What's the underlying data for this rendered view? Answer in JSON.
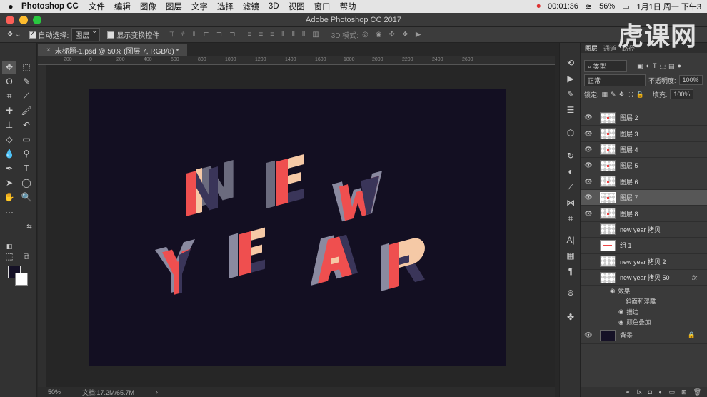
{
  "menubar": {
    "app_name": "Photoshop CC",
    "items": [
      "文件",
      "编辑",
      "图像",
      "图层",
      "文字",
      "选择",
      "滤镜",
      "3D",
      "视图",
      "窗口",
      "帮助"
    ],
    "time": "00:01:36",
    "battery": "56%",
    "date": "1月1日 周一 下午3"
  },
  "window": {
    "title": "Adobe Photoshop CC 2017"
  },
  "watermark": "虎课网",
  "options": {
    "auto_select_label": "自动选择:",
    "auto_select_value": "图层",
    "transform_label": "显示变换控件",
    "mode_3d_label": "3D 模式:"
  },
  "document": {
    "tab_title": "未标题-1.psd @ 50% (图层 7, RGB/8) *",
    "zoom": "50%",
    "doc_size": "文档:17.2M/65.7M",
    "ruler_ticks": [
      "200",
      "0",
      "200",
      "400",
      "600",
      "800",
      "1000",
      "1200",
      "1400",
      "1600",
      "1800",
      "2000",
      "2200",
      "2400",
      "2600"
    ],
    "artwork_lines": [
      "NEW",
      "YEAR"
    ]
  },
  "colors": {
    "foreground": "#151126",
    "background": "#ffffff",
    "canvas": "#130f22",
    "letter_red": "#ef4f4f",
    "letter_peach": "#f5c9a6",
    "letter_purple": "#3a3559"
  },
  "layers_panel": {
    "tabs": [
      "图层",
      "通道",
      "路径"
    ],
    "filter_label": "类型",
    "blend_mode": "正常",
    "opacity_label": "不透明度:",
    "opacity_value": "100%",
    "lock_label": "锁定:",
    "fill_label": "填充:",
    "fill_value": "100%",
    "layers": [
      {
        "name": "图层 2",
        "visible": true
      },
      {
        "name": "图层 3",
        "visible": true
      },
      {
        "name": "图层 4",
        "visible": true
      },
      {
        "name": "图层 5",
        "visible": true
      },
      {
        "name": "图层 6",
        "visible": true
      },
      {
        "name": "图层 7",
        "visible": true,
        "selected": true
      },
      {
        "name": "图层 8",
        "visible": true
      },
      {
        "name": "new year 拷贝",
        "visible": false
      },
      {
        "name": "组 1",
        "visible": false
      },
      {
        "name": "new year 拷贝 2",
        "visible": false
      },
      {
        "name": "new year 拷贝 50",
        "visible": false,
        "fx": "fx"
      }
    ],
    "effects": {
      "label": "效果",
      "items": [
        "斜面和浮雕",
        "描边",
        "颜色叠加"
      ]
    },
    "background_layer": "背景"
  }
}
